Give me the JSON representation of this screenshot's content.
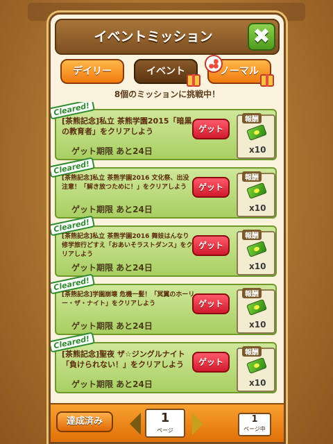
{
  "dialog": {
    "title": "イベントミッション",
    "close_label": "✖"
  },
  "tabs": [
    {
      "label": "デイリー",
      "active": false
    },
    {
      "label": "イベント",
      "active": true
    },
    {
      "label": "ノーマル",
      "active": false
    }
  ],
  "challenge_text": "8個のミッションに挑戦中！",
  "cleared_label": "Cleared!",
  "get_label": "ゲット",
  "reward_label": "報酬",
  "missions": [
    {
      "title": "[茶熊記念]私立 茶熊学園2015「暗黒の教育者」をクリアしよう",
      "deadline": "ゲット期限 あと24日",
      "reward_icon": "ticket-icon",
      "reward_qty": "x10"
    },
    {
      "title": "[茶熊記念]私立 茶熊学園2016 文化祭、出没注意！「解き放つために！」をクリアしよう",
      "deadline": "ゲット期限 あと24日",
      "reward_icon": "ticket-icon",
      "reward_qty": "x10"
    },
    {
      "title": "[茶熊記念]私立 茶熊学園2016 舞妓はんなり修学旅行どすえ「おあいそラストダンス」をクリアしよう",
      "deadline": "ゲット期限 あと24日",
      "reward_icon": "ticket-icon",
      "reward_qty": "x10"
    },
    {
      "title": "[茶熊記念]学園崩壊 危機一髪！「冥翼のホーリー・ザ・ナイト」をクリアしよう",
      "deadline": "ゲット期限 あと24日",
      "reward_icon": "ticket-icon",
      "reward_qty": "x10"
    },
    {
      "title": "[茶熊記念]聖夜 ザ☆ジングルナイト「負けられない！」をクリアしよう",
      "deadline": "ゲット期限 あと24日",
      "reward_icon": "ticket-icon",
      "reward_qty": "x10"
    }
  ],
  "footer": {
    "done_label": "達成済み",
    "page": "1",
    "page_unit": "ページ",
    "total": "1",
    "total_unit": "ページ中"
  }
}
